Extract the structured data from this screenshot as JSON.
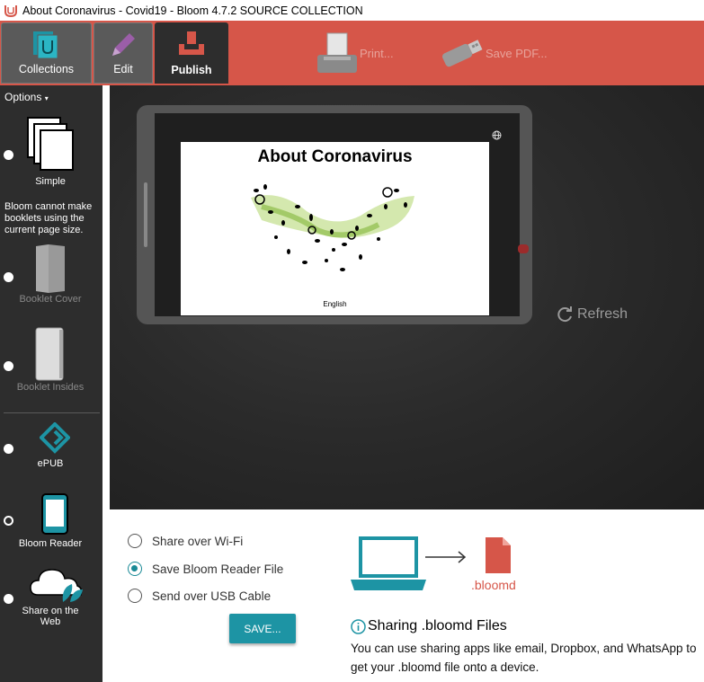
{
  "window": {
    "title": "About Coronavirus - Covid19 - Bloom 4.7.2 SOURCE COLLECTION"
  },
  "tabs": [
    {
      "label": "Collections",
      "icon": "collections-icon"
    },
    {
      "label": "Edit",
      "icon": "pencil-icon"
    },
    {
      "label": "Publish",
      "icon": "publish-icon",
      "active": true
    }
  ],
  "toolbar": {
    "print_label": "Print...",
    "savepdf_label": "Save PDF..."
  },
  "left_panel": {
    "options_label": "Options",
    "warning": "Bloom cannot make booklets using the current page size.",
    "modes": [
      {
        "label": "Simple",
        "icon": "pages-icon",
        "enabled": true,
        "selected": false
      },
      {
        "label": "Booklet Cover",
        "icon": "booklet-cover-icon",
        "enabled": false,
        "selected": false
      },
      {
        "label": "Booklet Insides",
        "icon": "booklet-insides-icon",
        "enabled": false,
        "selected": false
      },
      {
        "label": "ePUB",
        "icon": "epub-icon",
        "enabled": true,
        "selected": false
      },
      {
        "label": "Bloom Reader",
        "icon": "phone-icon",
        "enabled": true,
        "selected": true
      },
      {
        "label": "Share on the Web",
        "icon": "cloud-icon",
        "enabled": true,
        "selected": false
      }
    ]
  },
  "preview": {
    "book_title": "About Coronavirus",
    "language": "English",
    "refresh_label": "Refresh"
  },
  "publish_methods": [
    {
      "label": "Share over Wi-Fi",
      "selected": false
    },
    {
      "label": "Save Bloom Reader File",
      "selected": true
    },
    {
      "label": "Send over USB Cable",
      "selected": false
    }
  ],
  "save_button": "SAVE...",
  "file_type_label": ".bloomd",
  "sharing": {
    "heading": "Sharing .bloomd Files",
    "body": "You can use sharing apps like email, Dropbox, and WhatsApp to get your .bloomd file onto a device."
  },
  "colors": {
    "accent": "#d65649",
    "teal": "#1d94a4",
    "panel": "#2d2d2d"
  }
}
